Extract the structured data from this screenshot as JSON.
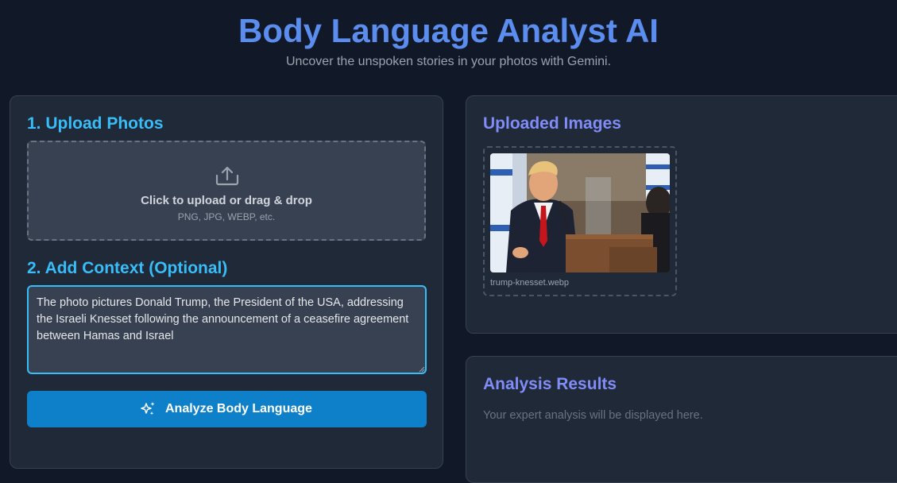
{
  "header": {
    "title": "Body Language Analyst AI",
    "subtitle": "Uncover the unspoken stories in your photos with Gemini."
  },
  "upload": {
    "heading": "1. Upload Photos",
    "main_text": "Click to upload or drag & drop",
    "sub_text": "PNG, JPG, WEBP, etc.",
    "icon": "upload-icon"
  },
  "context": {
    "heading": "2. Add Context (Optional)",
    "value": "The photo pictures Donald Trump, the President of the USA, addressing the Israeli Knesset following the announcement of a ceasefire agreement between Hamas and Israel"
  },
  "analyze_button": {
    "label": "Analyze Body Language",
    "icon": "sparkles-icon"
  },
  "uploaded": {
    "heading": "Uploaded Images",
    "images": [
      {
        "file_name": "trump-knesset.webp"
      }
    ]
  },
  "results": {
    "heading": "Analysis Results",
    "placeholder": "Your expert analysis will be displayed here."
  },
  "colors": {
    "background": "#111827",
    "panel": "#1f2937",
    "title_accent": "#5b8def",
    "heading_blue": "#38bdf8",
    "heading_violet": "#818cf8",
    "button": "#0e80c9"
  }
}
